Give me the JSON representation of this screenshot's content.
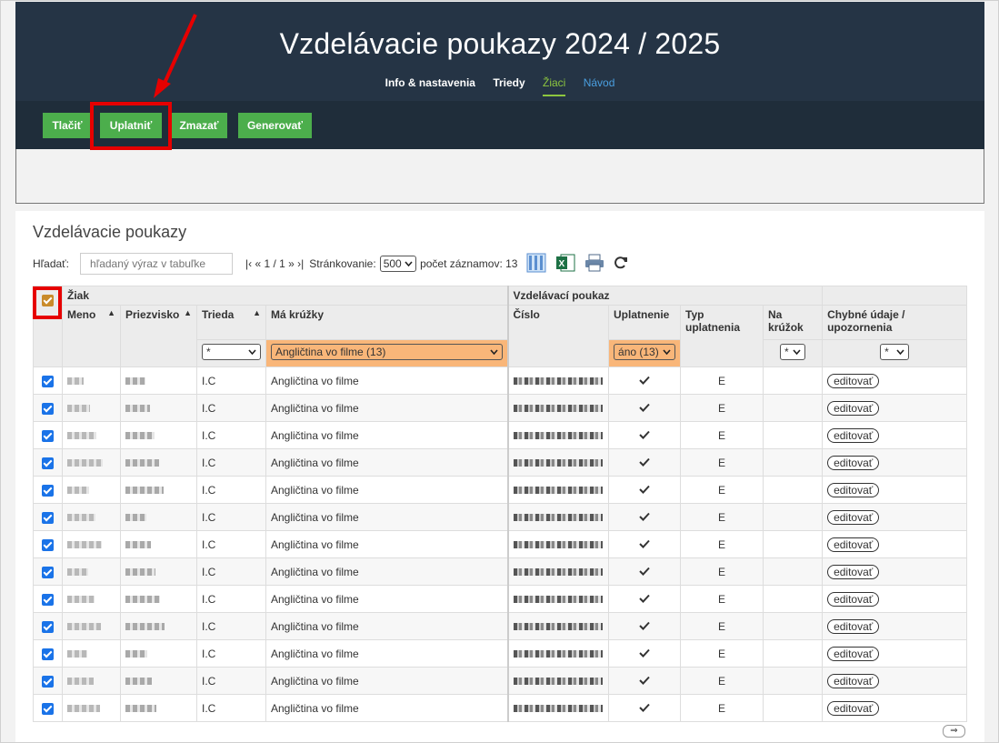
{
  "header": {
    "title": "Vzdelávacie poukazy 2024 / 2025",
    "nav": [
      "Info & nastavenia",
      "Triedy",
      "Žiaci",
      "Návod"
    ],
    "active_nav": "Žiaci"
  },
  "toolbar": {
    "print": "Tlačiť",
    "apply": "Uplatniť",
    "delete": "Zmazať",
    "generate": "Generovať"
  },
  "section": {
    "title": "Vzdelávacie poukazy",
    "search_label": "Hľadať:",
    "search_placeholder": "hľadaný výraz v tabuľke",
    "pager": "|‹ « 1 / 1 » ›|",
    "paging_label": "Stránkovanie:",
    "paging_value": "500",
    "count_label": "počet záznamov: 13"
  },
  "table": {
    "group_student": "Žiak",
    "group_voucher": "Vzdelávací poukaz",
    "col_first": "Meno",
    "col_last": "Priezvisko",
    "col_class": "Trieda",
    "col_clubs": "Má krúžky",
    "col_number": "Číslo",
    "col_applied": "Uplatnenie",
    "col_type": "Typ uplatnenia",
    "col_club": "Na krúžok",
    "col_errors": "Chybné údaje / upozornenia",
    "filter_class": "*",
    "filter_clubs": "Angličtina vo filme (13)",
    "filter_applied": "áno (13)",
    "filter_club": "*",
    "filter_errors": "*",
    "row_class": "I.C",
    "row_club": "Angličtina vo filme",
    "row_type": "E",
    "row_edit": "editovať",
    "row_count": 13
  },
  "colors": {
    "header_bg": "#253445",
    "button_green": "#4cae4c",
    "active_nav": "#8dc63f",
    "filter_highlight": "#f9b679",
    "annotation_red": "#e60000"
  }
}
